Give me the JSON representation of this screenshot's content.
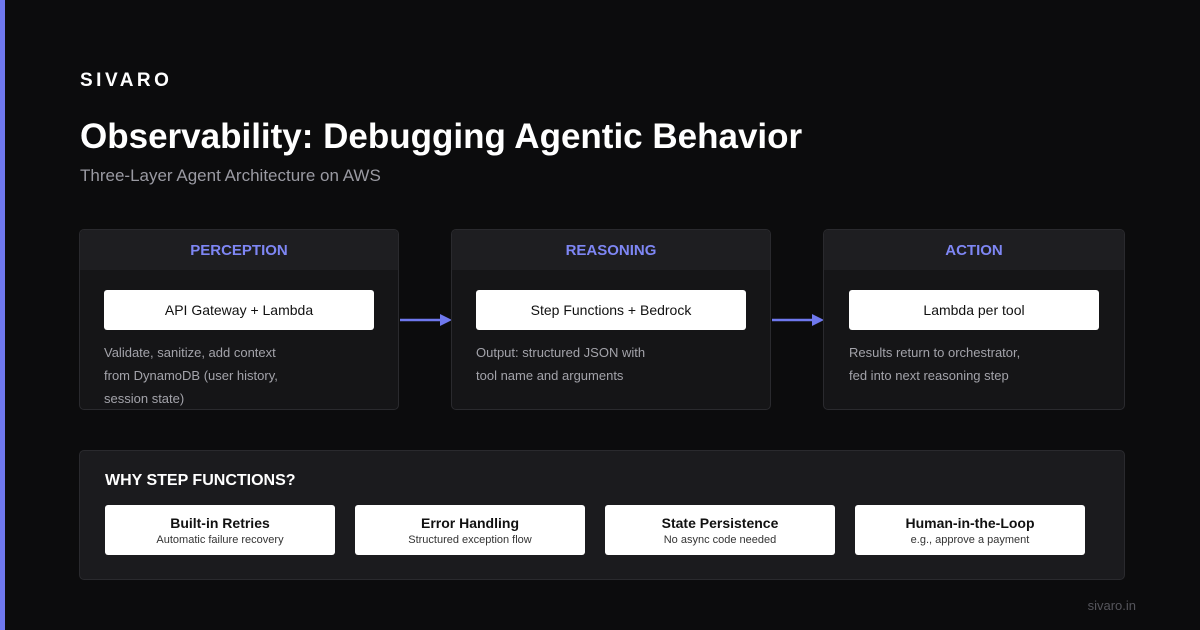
{
  "brand": "SIVARO",
  "title": "Observability: Debugging Agentic Behavior",
  "subtitle": "Three-Layer Agent Architecture on AWS",
  "layers": [
    {
      "header": "PERCEPTION",
      "service": "API Gateway + Lambda",
      "description": [
        "Validate, sanitize, add context",
        "from DynamoDB (user history,",
        "session state)"
      ]
    },
    {
      "header": "REASONING",
      "service": "Step Functions + Bedrock",
      "description": [
        "Output: structured JSON with",
        "tool name and arguments"
      ]
    },
    {
      "header": "ACTION",
      "service": "Lambda per tool",
      "description": [
        "Results return to orchestrator,",
        "fed into next reasoning step"
      ]
    }
  ],
  "why": {
    "title": "WHY STEP FUNCTIONS?",
    "features": [
      {
        "title": "Built-in Retries",
        "subtitle": "Automatic failure recovery"
      },
      {
        "title": "Error Handling",
        "subtitle": "Structured exception flow"
      },
      {
        "title": "State Persistence",
        "subtitle": "No async code needed"
      },
      {
        "title": "Human-in-the-Loop",
        "subtitle": "e.g., approve a payment"
      }
    ]
  },
  "footer": "sivaro.in",
  "colors": {
    "accent": "#6f78ee",
    "header_text": "#7e86f4",
    "background": "#0c0c0d",
    "card": "#151517"
  }
}
